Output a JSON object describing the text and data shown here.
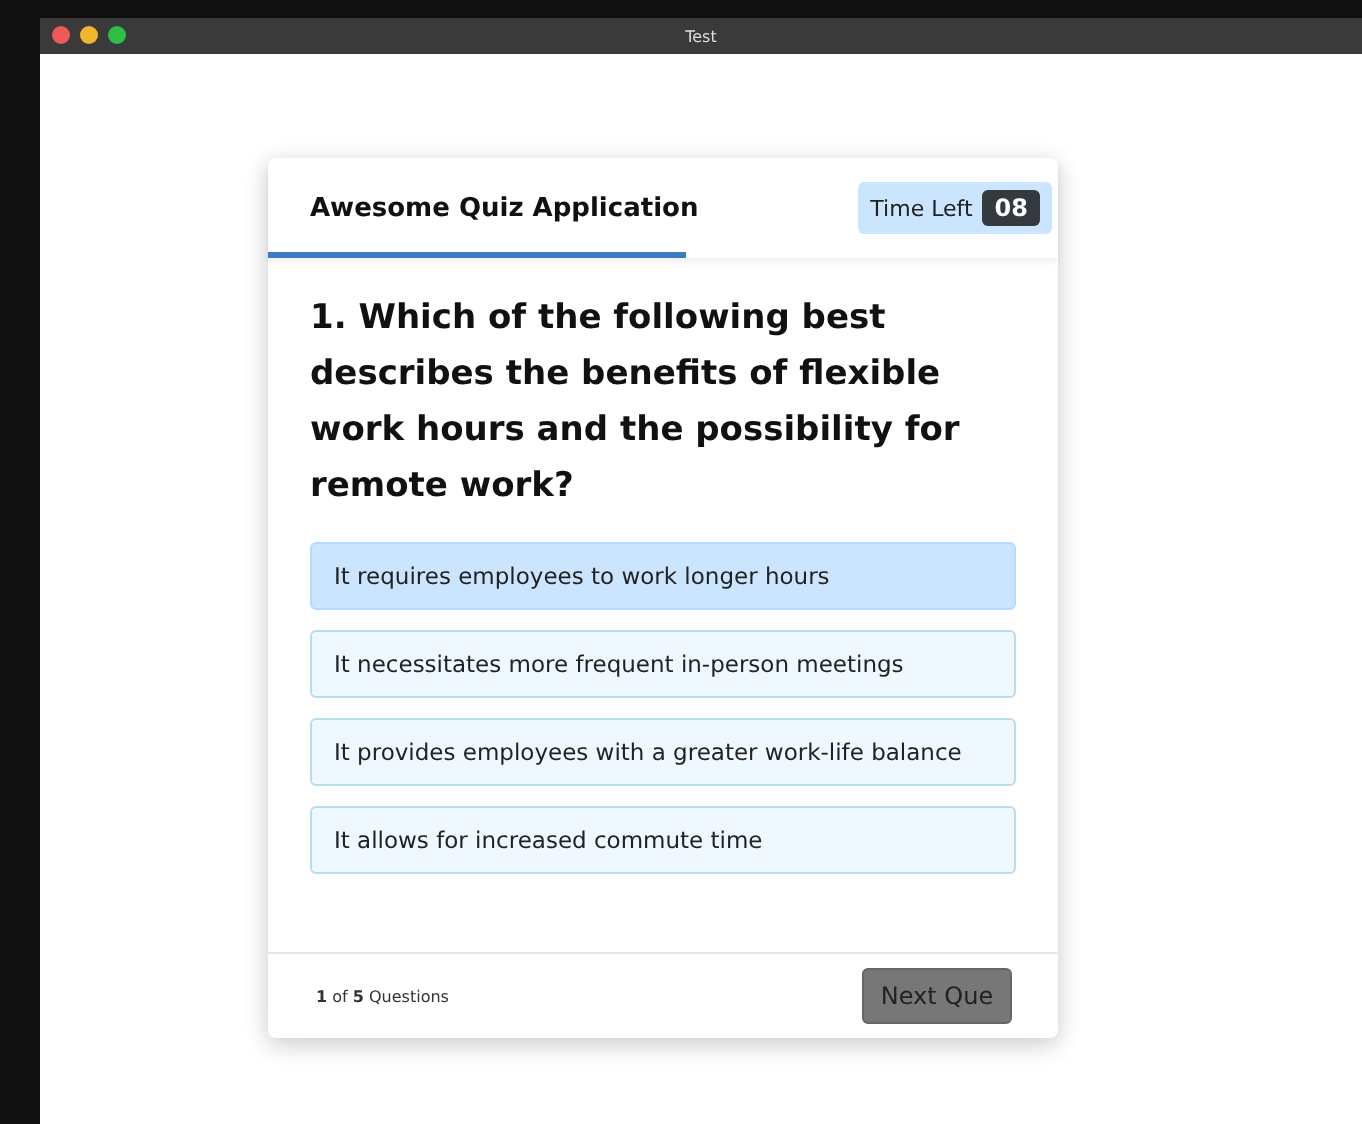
{
  "window": {
    "title": "Test"
  },
  "quiz": {
    "title": "Awesome Quiz Application",
    "timer_label": "Time Left",
    "timer_value": "08",
    "time_line": {
      "level": 0.53
    },
    "question": "1. Which of the following best describes the benefits of flexible work hours and the possibility for remote work?",
    "options": [
      {
        "text": "It requires employees to work longer hours",
        "selected": true
      },
      {
        "text": "It necessitates more frequent in-person meetings",
        "selected": false
      },
      {
        "text": "It provides employees with a greater work-life balance",
        "selected": false
      },
      {
        "text": "It allows for increased commute time",
        "selected": false
      }
    ],
    "progress": "**1** of **5** Questions",
    "next_button": "Next Que"
  }
}
